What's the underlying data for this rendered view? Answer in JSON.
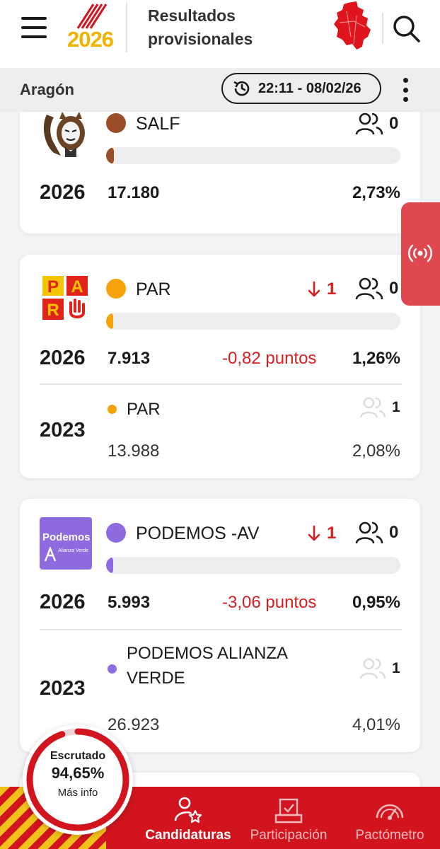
{
  "header": {
    "logo_year": "2026",
    "title": "Resultados provisionales",
    "menu_icon": "hamburger-menu-icon",
    "search_icon": "search-icon",
    "map_icon": "aragon-map-icon"
  },
  "subheader": {
    "region": "Aragón",
    "timestamp": "22:11 - 08/02/26"
  },
  "colors": {
    "brand_red": "#d1141e",
    "salf": "#9a4e28",
    "par": "#f5a30a",
    "podemos": "#8e6ce0",
    "negative": "#d61f1f"
  },
  "parties": [
    {
      "name": "SALF",
      "seats": "0",
      "year": "2026",
      "votes": "17.180",
      "percent": "2,73%",
      "share": 0.0273
    },
    {
      "name": "PAR",
      "seat_change": "1",
      "seats": "0",
      "year": "2026",
      "votes": "7.913",
      "diff": "-0,82 puntos",
      "percent": "1,26%",
      "share": 0.0126,
      "logo_text": "PAR",
      "previous": {
        "year": "2023",
        "name": "PAR",
        "seats": "1",
        "votes": "13.988",
        "percent": "2,08%"
      }
    },
    {
      "name": "PODEMOS -AV",
      "seat_change": "1",
      "seats": "0",
      "year": "2026",
      "votes": "5.993",
      "diff": "-3,06 puntos",
      "percent": "0,95%",
      "share": 0.0095,
      "logo_text": "Podemos",
      "logo_sub": "Alianza Verde",
      "previous": {
        "year": "2023",
        "name": "PODEMOS ALIANZA VERDE",
        "seats": "1",
        "votes": "26.923",
        "percent": "4,01%"
      }
    }
  ],
  "scrutiny": {
    "title": "Escrutado",
    "percent": "94,65%",
    "more": "Más info",
    "fraction": 0.9465
  },
  "bottom_nav": [
    {
      "label": "Candidaturas",
      "icon": "candidates-icon",
      "active": true
    },
    {
      "label": "Participación",
      "icon": "ballot-box-icon",
      "active": false
    },
    {
      "label": "Pactómetro",
      "icon": "gauge-icon",
      "active": false
    }
  ],
  "live_icon": "live-broadcast-icon"
}
